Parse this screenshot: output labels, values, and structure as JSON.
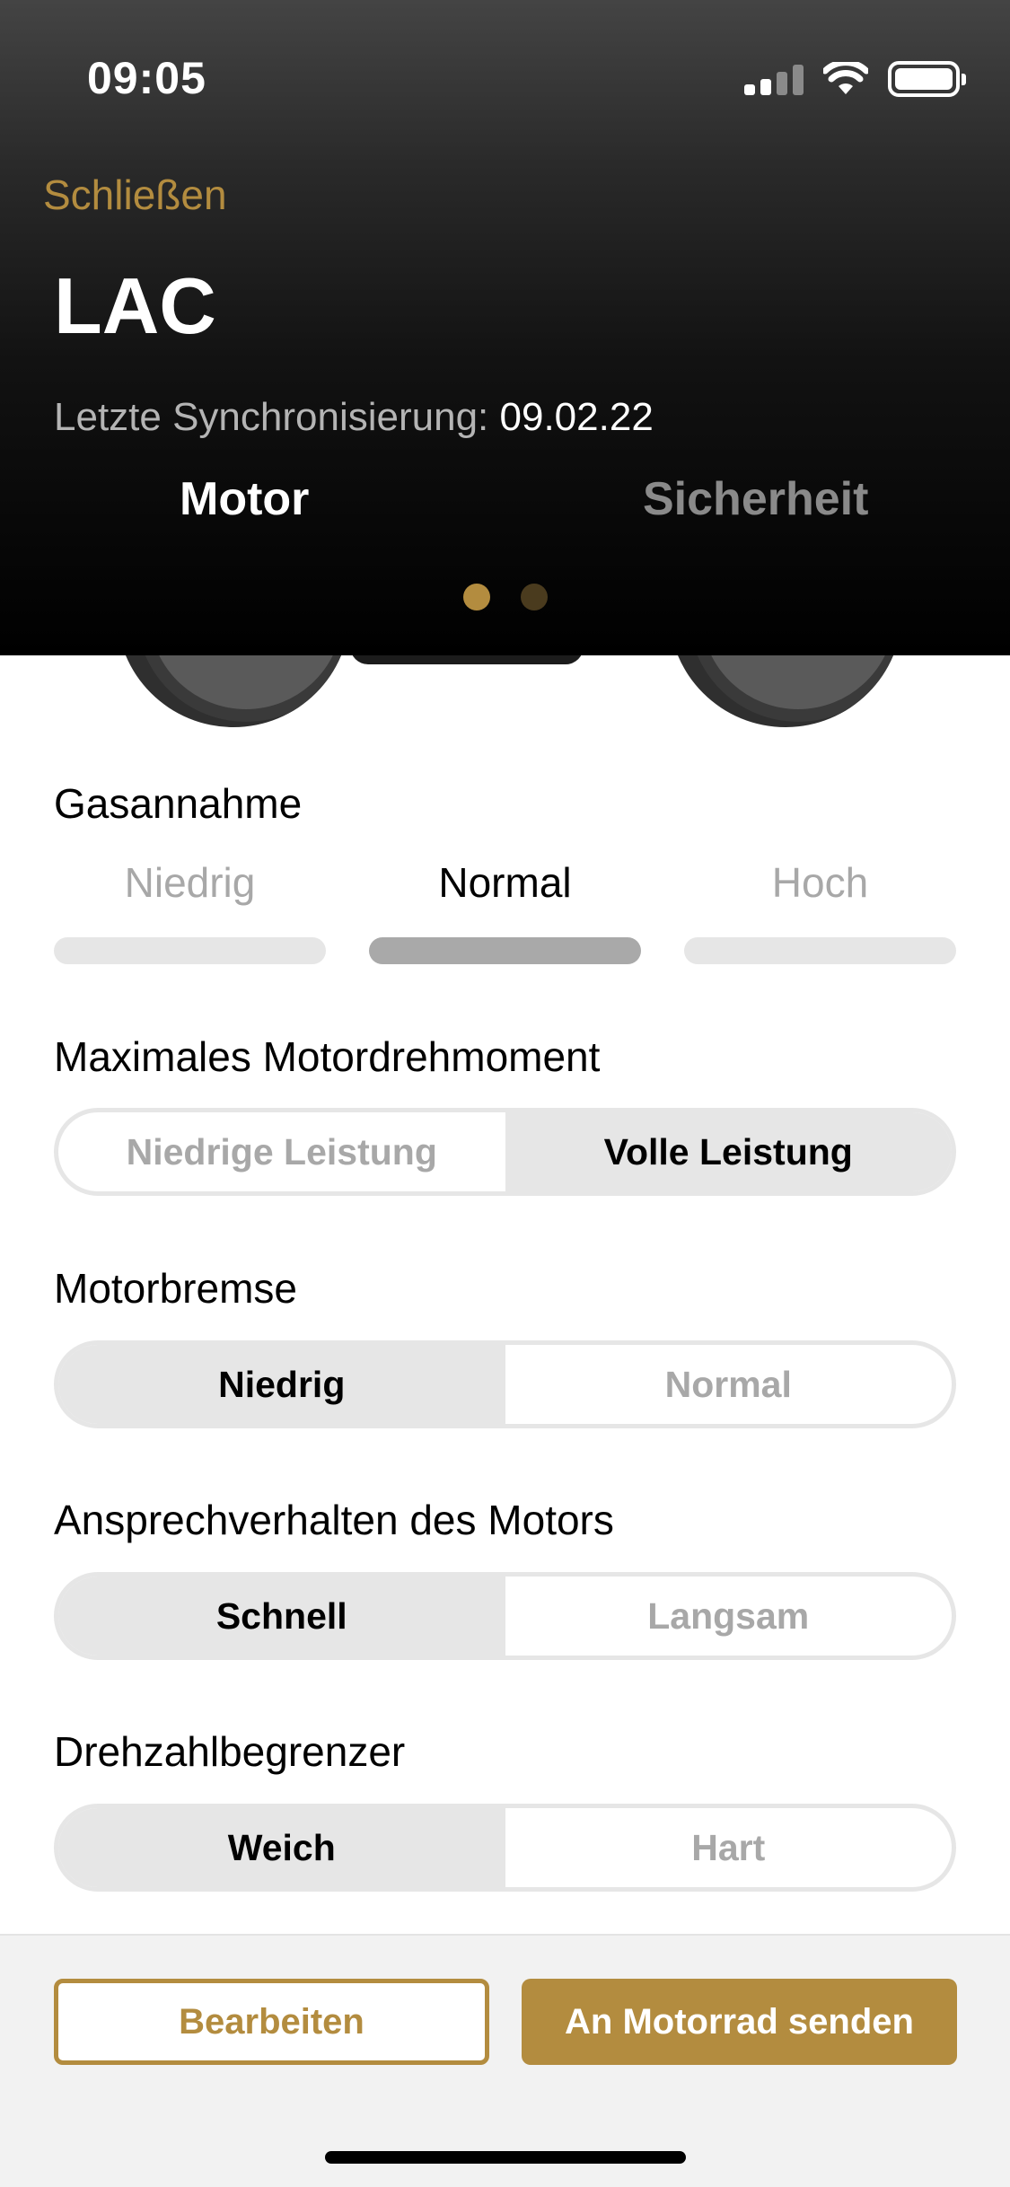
{
  "status_bar": {
    "time": "09:05"
  },
  "header": {
    "close_label": "Schließen",
    "title": "LAC",
    "sync_label": "Letzte Synchronisierung:",
    "sync_date": "09.02.22",
    "tabs": [
      {
        "label": "Motor",
        "active": true
      },
      {
        "label": "Sicherheit",
        "active": false
      }
    ],
    "page_dots": {
      "count": 2,
      "active_index": 0
    }
  },
  "colors": {
    "accent": "#b38c3f",
    "selected_segment": "#e6e6e6",
    "level_selected": "#a9a9a9"
  },
  "settings": {
    "throttle": {
      "title": "Gasannahme",
      "options": [
        "Niedrig",
        "Normal",
        "Hoch"
      ],
      "selected_index": 1
    },
    "torque": {
      "title": "Maximales Motordrehmoment",
      "options": [
        "Niedrige Leistung",
        "Volle Leistung"
      ],
      "selected_index": 1
    },
    "engine_brake": {
      "title": "Motorbremse",
      "options": [
        "Niedrig",
        "Normal"
      ],
      "selected_index": 0
    },
    "engine_response": {
      "title": "Ansprechverhalten des Motors",
      "options": [
        "Schnell",
        "Langsam"
      ],
      "selected_index": 0
    },
    "rev_limiter": {
      "title": "Drehzahlbegrenzer",
      "options": [
        "Weich",
        "Hart"
      ],
      "selected_index": 0
    }
  },
  "footer": {
    "edit_label": "Bearbeiten",
    "send_label": "An Motorrad senden"
  }
}
